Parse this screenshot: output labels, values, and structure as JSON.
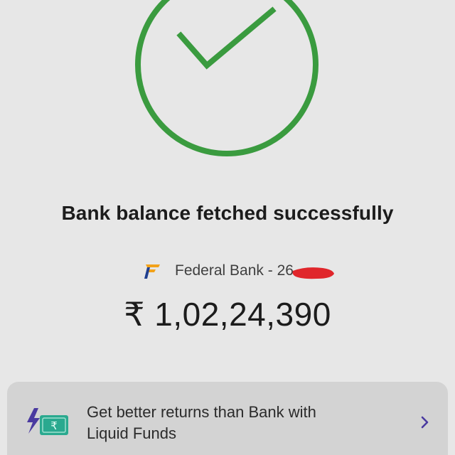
{
  "status": {
    "icon": "checkmark-circle-icon",
    "title": "Bank balance fetched successfully"
  },
  "account": {
    "logo_icon": "federal-bank-logo-icon",
    "bank_label": "Federal Bank - 26",
    "balance": "₹ 1,02,24,390"
  },
  "promo": {
    "icon": "lightning-rupee-cash-icon",
    "text_line1": "Get better returns than Bank with",
    "text_line2": "Liquid Funds",
    "chevron_icon": "chevron-right-icon"
  },
  "colors": {
    "background": "#e7e7e7",
    "success_green": "#3a9b3f",
    "promo_card": "#d3d3d3",
    "accent_purple": "#4a3aa0",
    "icon_teal": "#2aa98f",
    "redaction_red": "#e0262b"
  }
}
